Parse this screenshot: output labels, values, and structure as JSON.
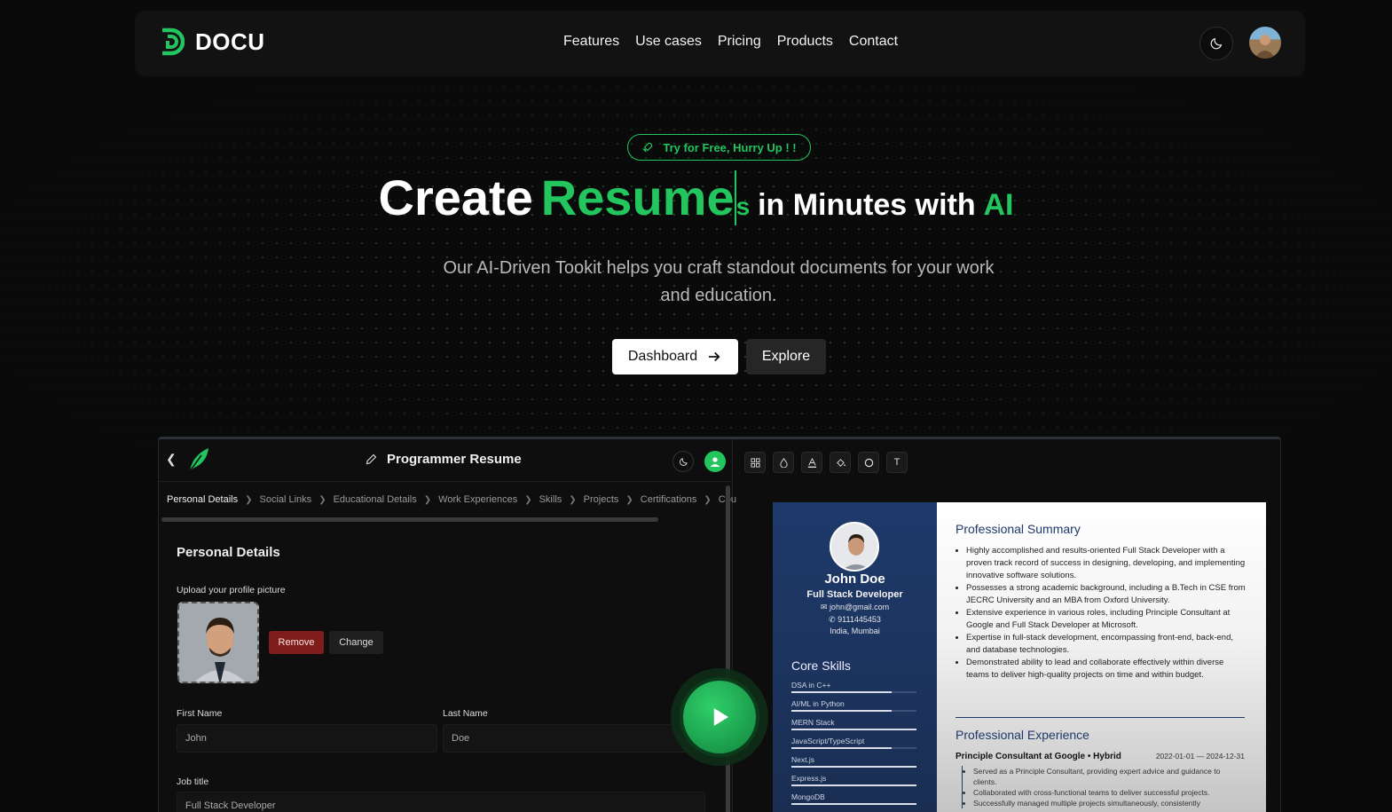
{
  "brand": {
    "name": "DOCU",
    "accent": "#22c55e"
  },
  "nav": {
    "links": [
      "Features",
      "Use cases",
      "Pricing",
      "Products",
      "Contact"
    ]
  },
  "hero": {
    "badge": "Try for Free, Hurry Up ! !",
    "title_create": "Create",
    "title_word": "Resume",
    "title_word_tail": "s",
    "title_rest": "in Minutes with",
    "title_ai": "AI",
    "subtitle": "Our AI-Driven Tookit helps you craft standout documents for your work and education.",
    "cta_primary": "Dashboard",
    "cta_secondary": "Explore"
  },
  "editor": {
    "doc_title": "Programmer Resume",
    "breadcrumbs": [
      "Personal Details",
      "Social Links",
      "Educational Details",
      "Work Experiences",
      "Skills",
      "Projects",
      "Certifications",
      "Cou"
    ],
    "section_title": "Personal Details",
    "upload_label": "Upload your profile picture",
    "remove_label": "Remove",
    "change_label": "Change",
    "first_name_label": "First Name",
    "first_name_value": "John",
    "last_name_label": "Last Name",
    "last_name_value": "Doe",
    "job_title_label": "Job title",
    "job_title_value": "Full Stack Developer"
  },
  "toolbar": {
    "icons": [
      "grid-icon",
      "drop-icon",
      "text-color-icon",
      "fill-icon",
      "circle-icon",
      "font-icon"
    ],
    "font_glyph": "T"
  },
  "resume": {
    "name": "John Doe",
    "role": "Full Stack Developer",
    "email": "john@gmail.com",
    "phone": "9111445453",
    "location": "India, Mumbai",
    "skills_title": "Core Skills",
    "skills": [
      {
        "name": "DSA in C++",
        "level": 0.8
      },
      {
        "name": "AI/ML in Python",
        "level": 0.8
      },
      {
        "name": "MERN Stack",
        "level": 1.0
      },
      {
        "name": "JavaScript/TypeScript",
        "level": 0.8
      },
      {
        "name": "Next.js",
        "level": 1.0
      },
      {
        "name": "Express.js",
        "level": 1.0
      },
      {
        "name": "MongoDB",
        "level": 1.0
      }
    ],
    "summary_title": "Professional Summary",
    "summary": [
      "Highly accomplished and results-oriented Full Stack Developer with a proven track record of success in designing, developing, and implementing innovative software solutions.",
      "Possesses a strong academic background, including a B.Tech in CSE from JECRC University and an MBA from Oxford University.",
      "Extensive experience in various roles, including Principle Consultant at Google and Full Stack Developer at Microsoft.",
      "Expertise in full-stack development, encompassing front-end, back-end, and database technologies.",
      "Demonstrated ability to lead and collaborate effectively within diverse teams to deliver high-quality projects on time and within budget."
    ],
    "experience_title": "Professional Experience",
    "job": "Principle Consultant at Google • Hybrid",
    "job_dates": "2022-01-01 — 2024-12-31",
    "job_points": [
      "Served as a Principle Consultant, providing expert advice and guidance to clients.",
      "Collaborated with cross-functional teams to deliver successful projects.",
      "Successfully managed multiple projects simultaneously, consistently"
    ]
  }
}
